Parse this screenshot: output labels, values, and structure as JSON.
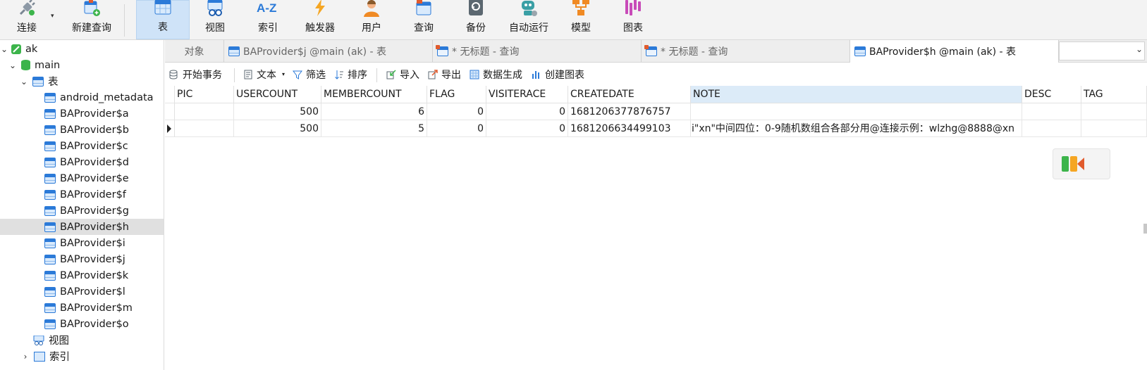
{
  "toolbar": {
    "connect": "连接",
    "new_query": "新建查询",
    "table": "表",
    "view": "视图",
    "index": "索引",
    "index_icon_text": "A-Z",
    "trigger": "触发器",
    "user": "用户",
    "query": "查询",
    "backup": "备份",
    "automation": "自动运行",
    "model": "模型",
    "chart": "图表"
  },
  "sidebar": {
    "connection": "ak",
    "database": "main",
    "tables_group": "表",
    "tables": [
      "android_metadata",
      "BAProvider$a",
      "BAProvider$b",
      "BAProvider$c",
      "BAProvider$d",
      "BAProvider$e",
      "BAProvider$f",
      "BAProvider$g",
      "BAProvider$h",
      "BAProvider$i",
      "BAProvider$j",
      "BAProvider$k",
      "BAProvider$l",
      "BAProvider$m",
      "BAProvider$o"
    ],
    "selected_table": "BAProvider$h",
    "views_group": "视图",
    "indexes_group": "索引"
  },
  "tabs": [
    {
      "label": "对象",
      "type": "objects"
    },
    {
      "label": "BAProvider$j @main (ak) - 表",
      "type": "table"
    },
    {
      "label": "* 无标题 - 查询",
      "type": "query"
    },
    {
      "label": "* 无标题 - 查询",
      "type": "query"
    },
    {
      "label": "BAProvider$h @main (ak) - 表",
      "type": "table",
      "active": true
    }
  ],
  "actions": {
    "begin_transaction": "开始事务",
    "text": "文本",
    "filter": "筛选",
    "sort": "排序",
    "import": "导入",
    "export": "导出",
    "data_generation": "数据生成",
    "create_chart": "创建图表"
  },
  "grid": {
    "columns": [
      "PIC",
      "USERCOUNT",
      "MEMBERCOUNT",
      "FLAG",
      "VISITERACE",
      "CREATEDATE",
      "NOTE",
      "DESC",
      "TAG"
    ],
    "rows": [
      [
        "",
        "500",
        "6",
        "0",
        "0",
        "1681206377876757",
        "",
        "",
        ""
      ],
      [
        "",
        "500",
        "5",
        "0",
        "0",
        "1681206634499103",
        "i\"xn\"中间四位：0-9随机数组合各部分用@连接示例：wlzhg@8888@xn",
        "",
        ""
      ]
    ],
    "current_row": 1
  },
  "colors": {
    "accent": "#2b7ad8",
    "active_toolbar": "#cfe3f8",
    "selected_row": "#e0e0e0"
  }
}
